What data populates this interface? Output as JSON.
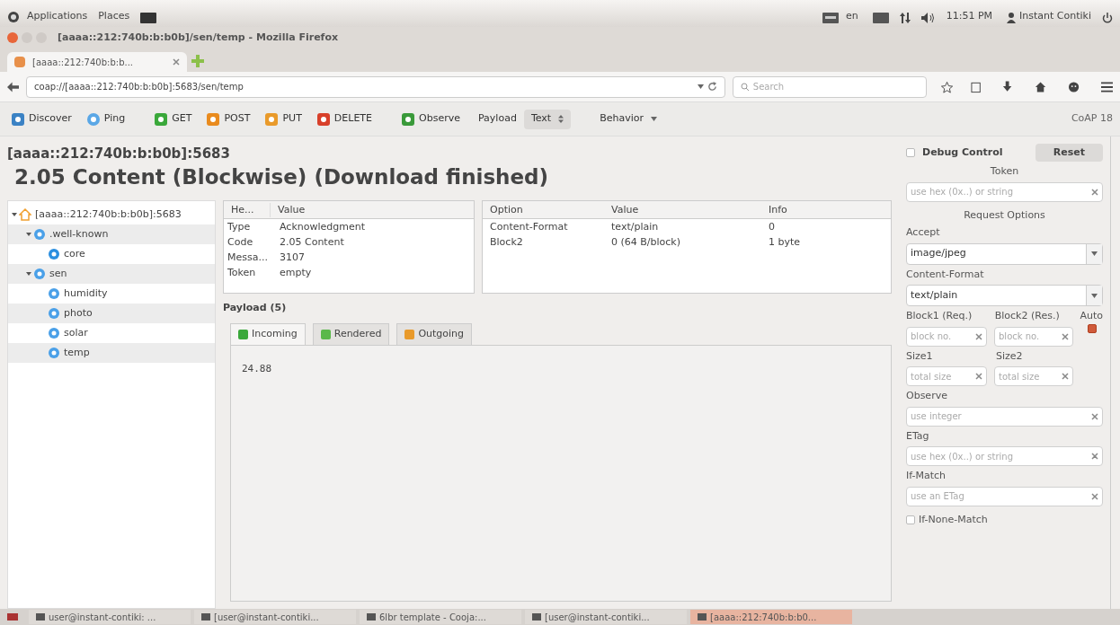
{
  "top_panel": {
    "menus": [
      "Applications",
      "Places"
    ],
    "language": "en",
    "clock": "11:51 PM",
    "user": "Instant Contiki"
  },
  "window": {
    "title": "[aaaa::212:740b:b:b0b]/sen/temp - Mozilla Firefox"
  },
  "tabs": [
    {
      "label": "[aaaa::212:740b:b:b...",
      "selected": true
    }
  ],
  "nav": {
    "url": "coap://[aaaa::212:740b:b:b0b]:5683/sen/temp",
    "search_placeholder": "Search"
  },
  "toolbar": {
    "buttons": [
      {
        "label": "Discover",
        "kind": "discover"
      },
      {
        "label": "Ping",
        "kind": "ping"
      },
      {
        "label": "GET",
        "kind": "get"
      },
      {
        "label": "POST",
        "kind": "post"
      },
      {
        "label": "PUT",
        "kind": "put"
      },
      {
        "label": "DELETE",
        "kind": "delete"
      },
      {
        "label": "Observe",
        "kind": "observe"
      }
    ],
    "payload_label": "Payload",
    "payload_format": "Text",
    "behavior": "Behavior",
    "brand": "CoAP 18"
  },
  "response": {
    "address": "[aaaa::212:740b:b:b0b]:5683",
    "status": "2.05 Content (Blockwise) (Download finished)"
  },
  "tree": [
    {
      "label": "[aaaa::212:740b:b:b0b]:5683",
      "kind": "host",
      "expanded": true,
      "children": [
        {
          "label": ".well-known",
          "kind": "folder",
          "expanded": true,
          "children": [
            {
              "label": "core",
              "kind": "discovery"
            }
          ]
        },
        {
          "label": "sen",
          "kind": "folder",
          "expanded": true,
          "children": [
            {
              "label": "humidity",
              "kind": "resource"
            },
            {
              "label": "photo",
              "kind": "resource"
            },
            {
              "label": "solar",
              "kind": "resource"
            },
            {
              "label": "temp",
              "kind": "resource"
            }
          ]
        }
      ]
    }
  ],
  "headers": {
    "columns": [
      "He...",
      "Value"
    ],
    "rows": [
      [
        "Type",
        "Acknowledgment"
      ],
      [
        "Code",
        "2.05 Content"
      ],
      [
        "Messa...",
        "3107"
      ],
      [
        "Token",
        "empty"
      ]
    ]
  },
  "options": {
    "columns": [
      "Option",
      "Value",
      "Info"
    ],
    "rows": [
      [
        "Content-Format",
        "text/plain",
        "0"
      ],
      [
        "Block2",
        "0 (64 B/block)",
        "1 byte"
      ]
    ]
  },
  "payload": {
    "title": "Payload (5)",
    "tabs": [
      {
        "label": "Incoming",
        "kind": "incoming",
        "selected": true
      },
      {
        "label": "Rendered",
        "kind": "rendered",
        "selected": false
      },
      {
        "label": "Outgoing",
        "kind": "outgoing",
        "selected": false
      }
    ],
    "content": "24.88"
  },
  "sidebar": {
    "debug_control": {
      "label": "Debug Control",
      "checked": false
    },
    "reset": "Reset",
    "token_label": "Token",
    "token_placeholder": "use hex (0x..) or string",
    "section": "Request Options",
    "accept": {
      "label": "Accept",
      "value": "image/jpeg"
    },
    "content_format": {
      "label": "Content-Format",
      "value": "text/plain"
    },
    "block1": {
      "label": "Block1 (Req.)",
      "placeholder": "block no."
    },
    "block2": {
      "label": "Block2 (Res.)",
      "placeholder": "block no."
    },
    "auto": {
      "label": "Auto",
      "checked": true
    },
    "size1": {
      "label": "Size1",
      "placeholder": "total size"
    },
    "size2": {
      "label": "Size2",
      "placeholder": "total size"
    },
    "observe": {
      "label": "Observe",
      "placeholder": "use integer"
    },
    "etag": {
      "label": "ETag",
      "placeholder": "use hex (0x..) or string"
    },
    "if_match": {
      "label": "If-Match",
      "placeholder": "use an ETag"
    },
    "if_none_match": {
      "label": "If-None-Match",
      "checked": false
    }
  },
  "taskbar": [
    {
      "label": "user@instant-contiki: ...",
      "selected": false
    },
    {
      "label": "[user@instant-contiki...",
      "selected": false
    },
    {
      "label": "6lbr template - Cooja:...",
      "selected": false
    },
    {
      "label": "[user@instant-contiki...",
      "selected": false
    },
    {
      "label": "[aaaa::212:740b:b:b0...",
      "selected": true
    }
  ]
}
